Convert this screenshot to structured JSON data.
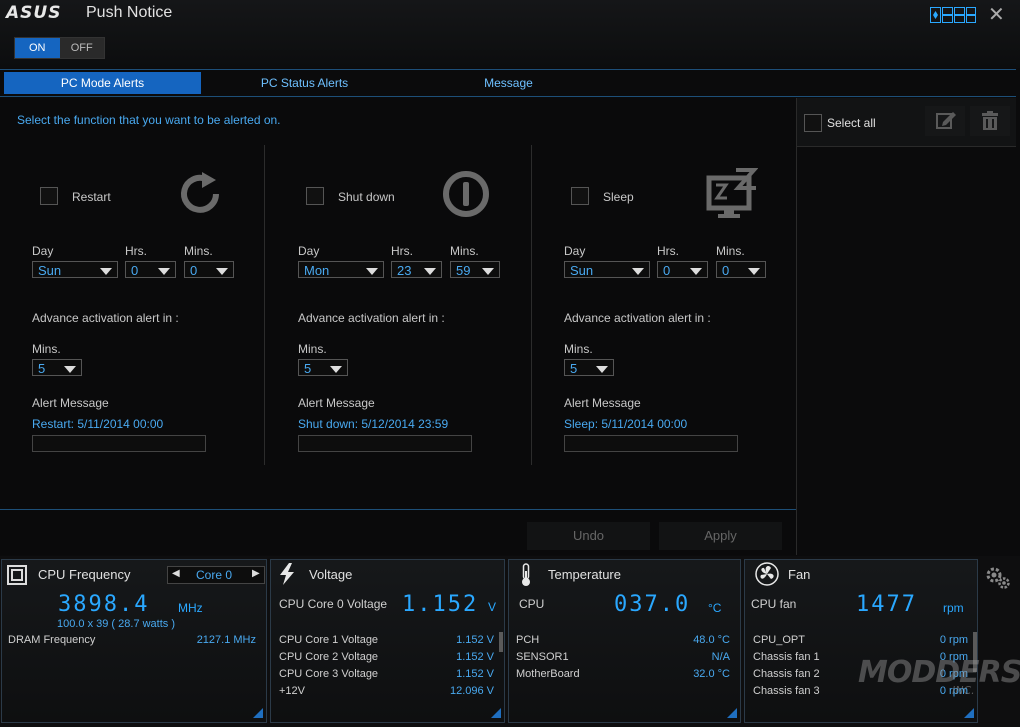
{
  "app": {
    "logo": "ASUS",
    "title": "Push Notice"
  },
  "power_toggle": {
    "on": "ON",
    "off": "OFF"
  },
  "tabs": [
    {
      "label": "PC Mode Alerts",
      "active": true
    },
    {
      "label": "PC Status Alerts",
      "active": false
    },
    {
      "label": "Message",
      "active": false
    }
  ],
  "instruction": "Select the function that you want to be alerted on.",
  "labels": {
    "day": "Day",
    "hrs": "Hrs.",
    "mins": "Mins.",
    "advance": "Advance activation alert in :",
    "alert_message": "Alert Message"
  },
  "modes": [
    {
      "name": "Restart",
      "icon": "restart-icon",
      "checked": false,
      "day": "Sun",
      "hrs": "0",
      "mins": "0",
      "advance_mins": "5",
      "alert": "Restart: 5/11/2014 00:00"
    },
    {
      "name": "Shut down",
      "icon": "power-icon",
      "checked": false,
      "day": "Mon",
      "hrs": "23",
      "mins": "59",
      "advance_mins": "5",
      "alert": "Shut down: 5/12/2014 23:59"
    },
    {
      "name": "Sleep",
      "icon": "sleep-monitor-icon",
      "checked": false,
      "day": "Sun",
      "hrs": "0",
      "mins": "0",
      "advance_mins": "5",
      "alert": "Sleep: 5/11/2014 00:00"
    }
  ],
  "buttons": {
    "undo": "Undo",
    "apply": "Apply"
  },
  "right_panel": {
    "select_all": "Select all"
  },
  "cpu": {
    "title": "CPU Frequency",
    "core_select": "Core 0",
    "freq": "3898.4",
    "freq_unit": "MHz",
    "detail": "100.0  x  39  ( 28.7     watts )",
    "dram_label": "DRAM Frequency",
    "dram_value": "2127.1  MHz"
  },
  "voltage": {
    "title": "Voltage",
    "main_label": "CPU Core 0 Voltage",
    "main_value": "1.152",
    "main_unit": "V",
    "rows": [
      {
        "label": "CPU Core 1 Voltage",
        "value": "1.152  V"
      },
      {
        "label": "CPU Core 2 Voltage",
        "value": "1.152  V"
      },
      {
        "label": "CPU Core 3 Voltage",
        "value": "1.152  V"
      },
      {
        "label": "+12V",
        "value": "12.096  V"
      }
    ]
  },
  "temperature": {
    "title": "Temperature",
    "main_label": "CPU",
    "main_value": "037.0",
    "main_unit": "°C",
    "rows": [
      {
        "label": "PCH",
        "value": "48.0 °C"
      },
      {
        "label": "SENSOR1",
        "value": "N/A"
      },
      {
        "label": "MotherBoard",
        "value": "32.0 °C"
      }
    ]
  },
  "fan": {
    "title": "Fan",
    "main_label": "CPU fan",
    "main_value": "1477",
    "main_unit": "rpm",
    "rows": [
      {
        "label": "CPU_OPT",
        "value": "0  rpm"
      },
      {
        "label": "Chassis fan 1",
        "value": "0  rpm"
      },
      {
        "label": "Chassis fan 2",
        "value": "0  rpm"
      },
      {
        "label": "Chassis fan 3",
        "value": "0  rpm"
      }
    ]
  },
  "watermark": {
    "text": "MODDERS",
    "sub": "INC."
  },
  "colors": {
    "accent": "#1565c0",
    "value_blue": "#2aa8ff",
    "link_blue": "#49a9f0"
  }
}
